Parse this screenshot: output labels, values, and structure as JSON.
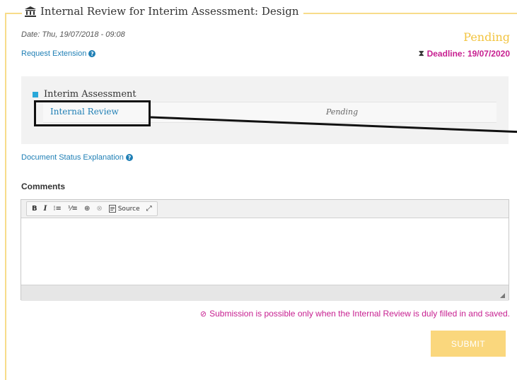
{
  "header": {
    "title": "Internal Review for Interim Assessment: Design",
    "icon": "institution-icon"
  },
  "meta": {
    "date": "Date: Thu, 19/07/2018 - 09:08",
    "request_extension": "Request Extension",
    "status": "Pending",
    "deadline": "Deadline: 19/07/2020"
  },
  "panel": {
    "section_title": "Interim Assessment",
    "rows": [
      {
        "label": "Internal Review",
        "status": "Pending"
      }
    ]
  },
  "document_status_explanation": "Document Status Explanation",
  "comments": {
    "label": "Comments",
    "toolbar": {
      "bold": "B",
      "italic": "I",
      "bulleted": "⁝≡",
      "numbered": "⅟≡",
      "link": "⊕",
      "unlink": "⊗",
      "source": "Source",
      "maximize": "⤢"
    },
    "value": ""
  },
  "warning": "Submission is possible only when the Internal Review is duly filled in and saved.",
  "submit_label": "SUBMIT",
  "colors": {
    "accent": "#f2c440",
    "link": "#1f7fb5",
    "deadline": "#c71f90",
    "submit_bg": "#fad77d"
  }
}
